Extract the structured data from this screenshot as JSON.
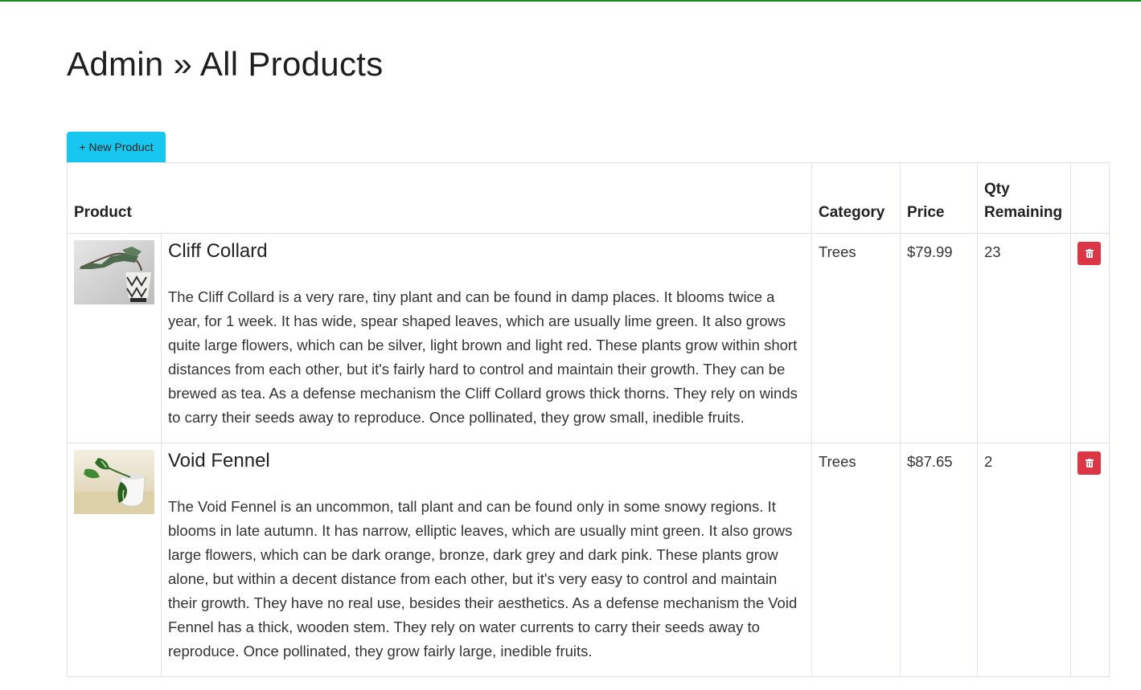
{
  "page": {
    "title": "Admin » All Products"
  },
  "toolbar": {
    "new_product_label": "+ New Product"
  },
  "table": {
    "headers": {
      "product": "Product",
      "category": "Category",
      "price": "Price",
      "qty": "Qty Remaining"
    },
    "rows": [
      {
        "name": "Cliff Collard",
        "description": "The Cliff Collard is a very rare, tiny plant and can be found in damp places. It blooms twice a year, for 1 week. It has wide, spear shaped leaves, which are usually lime green. It also grows quite large flowers, which can be silver, light brown and light red. These plants grow within short distances from each other, but it's fairly hard to control and maintain their growth. They can be brewed as tea. As a defense mechanism the Cliff Collard grows thick thorns. They rely on winds to carry their seeds away to reproduce. Once pollinated, they grow small, inedible fruits.",
        "category": "Trees",
        "price": "$79.99",
        "qty": "23"
      },
      {
        "name": "Void Fennel",
        "description": "The Void Fennel is an uncommon, tall plant and can be found only in some snowy regions. It blooms in late autumn. It has narrow, elliptic leaves, which are usually mint green. It also grows large flowers, which can be dark orange, bronze, dark grey and dark pink. These plants grow alone, but within a decent distance from each other, but it's very easy to control and maintain their growth. They have no real use, besides their aesthetics. As a defense mechanism the Void Fennel has a thick, wooden stem. They rely on water currents to carry their seeds away to reproduce. Once pollinated, they grow fairly large, inedible fruits.",
        "category": "Trees",
        "price": "$87.65",
        "qty": "2"
      }
    ]
  },
  "colors": {
    "accent_bar": "#1a8a1a",
    "new_button": "#17c7ef",
    "delete_button": "#dc3545"
  },
  "icons": {
    "delete": "trash-icon"
  }
}
